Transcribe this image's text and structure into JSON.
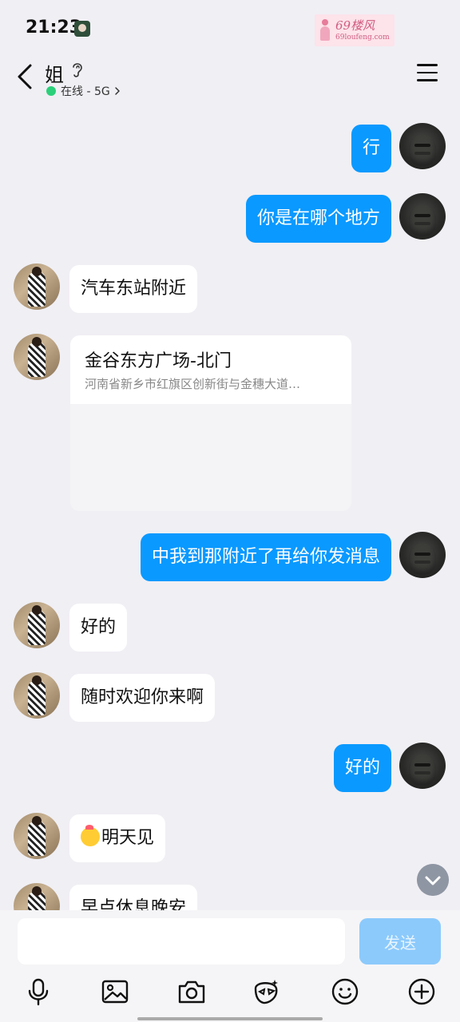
{
  "status_bar": {
    "time": "21:23",
    "watermark_title": "69楼风",
    "watermark_subtitle": "69loufeng.com"
  },
  "header": {
    "contact_name": "姐",
    "online_status": "在线 - 5G"
  },
  "messages": [
    {
      "side": "me",
      "text": "行"
    },
    {
      "side": "me",
      "text": "你是在哪个地方"
    },
    {
      "side": "her",
      "text": "汽车东站附近"
    },
    {
      "side": "her",
      "type": "location",
      "title": "金谷东方广场-北门",
      "address": "河南省新乡市红旗区创新街与金穗大道…"
    },
    {
      "side": "me",
      "text": "中我到那附近了再给你发消息"
    },
    {
      "side": "her",
      "text": "好的"
    },
    {
      "side": "her",
      "text": "随时欢迎你来啊"
    },
    {
      "side": "me",
      "text": "好的"
    },
    {
      "side": "her",
      "text": "明天见",
      "emoji": "hug-emoji"
    },
    {
      "side": "her",
      "text": "早点休息晚安"
    }
  ],
  "input": {
    "placeholder": "",
    "send_label": "发送"
  },
  "toolbar": [
    "mic-icon",
    "image-icon",
    "camera-icon",
    "sticker-icon",
    "emoji-icon",
    "plus-icon"
  ],
  "colors": {
    "background": "#f0eff4",
    "my_bubble": "#0a99ff",
    "her_bubble": "#ffffff",
    "online_dot": "#2bd07a",
    "send_button": "#8ccafc"
  }
}
